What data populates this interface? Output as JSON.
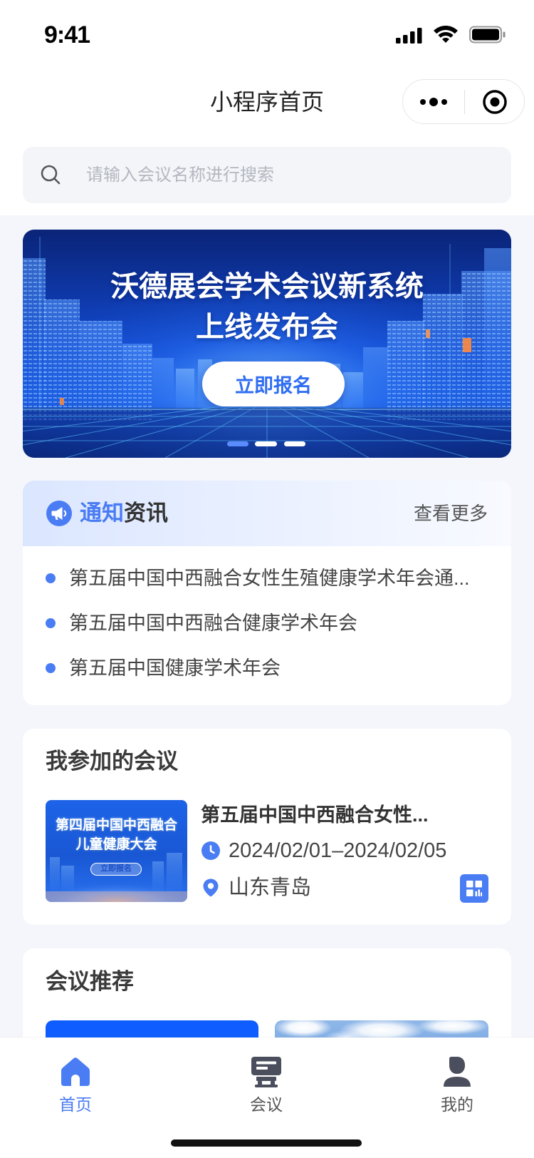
{
  "status_bar": {
    "time": "9:41",
    "icons": [
      "signal-icon",
      "wifi-icon",
      "battery-icon"
    ]
  },
  "nav_bar": {
    "title": "小程序首页",
    "capsule_icons": [
      "more-icon",
      "target-icon"
    ]
  },
  "search": {
    "placeholder": "请输入会议名称进行搜索",
    "icon": "search-icon"
  },
  "banner": {
    "title_line1": "沃德展会学术会议新系统",
    "title_line2": "上线发布会",
    "cta_label": "立即报名",
    "slide_count": 3,
    "active_slide": 1
  },
  "notices": {
    "icon": "megaphone-icon",
    "title_highlight": "通知",
    "title_rest": "资讯",
    "more_label": "查看更多",
    "items": [
      "第五届中国中西融合女性生殖健康学术年会通...",
      "第五届中国中西融合健康学术年会",
      "第五届中国健康学术年会"
    ]
  },
  "my_meetings": {
    "title": "我参加的会议",
    "items": [
      {
        "poster_line1": "第四届中国中西融合",
        "poster_line2": "儿童健康大会",
        "poster_cta": "立即报名",
        "title": "第五届中国中西融合女性...",
        "date_range": "2024/02/01–2024/02/05",
        "location": "山东青岛",
        "date_icon": "clock-icon",
        "location_icon": "location-pin-icon",
        "action_icon": "qr-code-icon"
      }
    ]
  },
  "recommend": {
    "title": "会议推荐"
  },
  "tab_bar": {
    "items": [
      {
        "label": "首页",
        "icon": "home-icon",
        "active": true
      },
      {
        "label": "会议",
        "icon": "meeting-icon",
        "active": false
      },
      {
        "label": "我的",
        "icon": "user-icon",
        "active": false
      }
    ]
  },
  "colors": {
    "accent": "#4a7cf3",
    "page_background": "#f4f6fb",
    "text_primary": "#333333",
    "tab_inactive": "#4b4e5c"
  }
}
